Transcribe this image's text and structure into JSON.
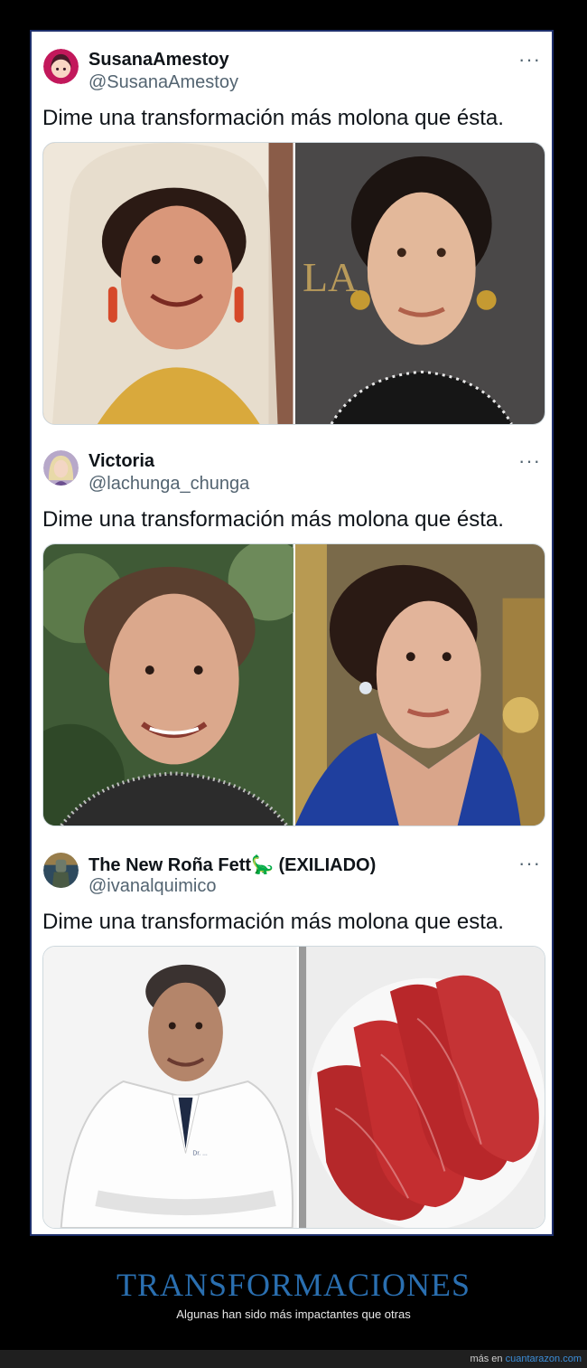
{
  "tweets": [
    {
      "name": "SusanaAmestoy",
      "handle": "@SusanaAmestoy",
      "text": "Dime una transformación más molona que ésta.",
      "more": "···"
    },
    {
      "name": "Victoria",
      "handle": "@lachunga_chunga",
      "text": "Dime una transformación más molona que ésta.",
      "more": "···"
    },
    {
      "name": "The New Roña Fett🦕 (EXILIADO)",
      "handle": "@ivanalquimico",
      "text": "Dime una transformación más molona que esta.",
      "more": "···"
    }
  ],
  "photo_text": {
    "backdrop_letters": "LA  ÓN",
    "coat_tag": "Dr. ..."
  },
  "caption": {
    "title": "TRANSFORMACIONES",
    "subtitle": "Algunas han sido más impactantes que otras"
  },
  "footer": {
    "prefix": "más en",
    "link": "cuantarazon.com"
  },
  "colors": {
    "frame_border": "#1e2f6b",
    "title": "#2a6fb0",
    "link": "#3d8ed8"
  }
}
